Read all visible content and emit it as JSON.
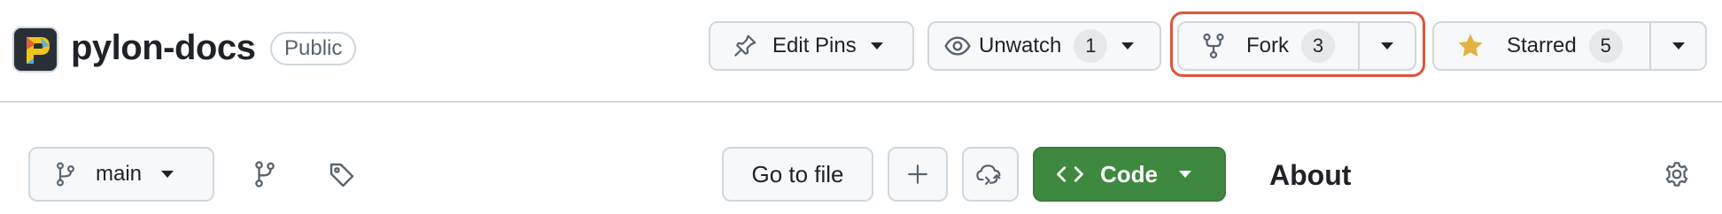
{
  "repo": {
    "name": "pylon-docs",
    "visibility": "Public"
  },
  "header_actions": {
    "edit_pins": {
      "label": "Edit Pins",
      "icon": "pin-icon"
    },
    "unwatch": {
      "label": "Unwatch",
      "count": "1",
      "icon": "eye-icon"
    },
    "fork": {
      "label": "Fork",
      "count": "3",
      "icon": "fork-icon",
      "highlighted": true,
      "highlight_color": "#e0533c"
    },
    "starred": {
      "label": "Starred",
      "count": "5",
      "icon": "star-icon",
      "star_color": "#e3b341"
    }
  },
  "file_nav": {
    "branch": {
      "label": "main",
      "icon": "branch-icon"
    },
    "branches_icon": "branches-icon",
    "tags_icon": "tag-icon",
    "go_to_file": "Go to file",
    "add_file_icon": "plus-icon",
    "codespaces_icon": "cloud-sync-icon",
    "code": {
      "label": "Code",
      "icon": "code-brackets-icon",
      "color": "#3e883f"
    }
  },
  "sidebar": {
    "about_heading": "About",
    "settings_icon": "gear-icon"
  }
}
